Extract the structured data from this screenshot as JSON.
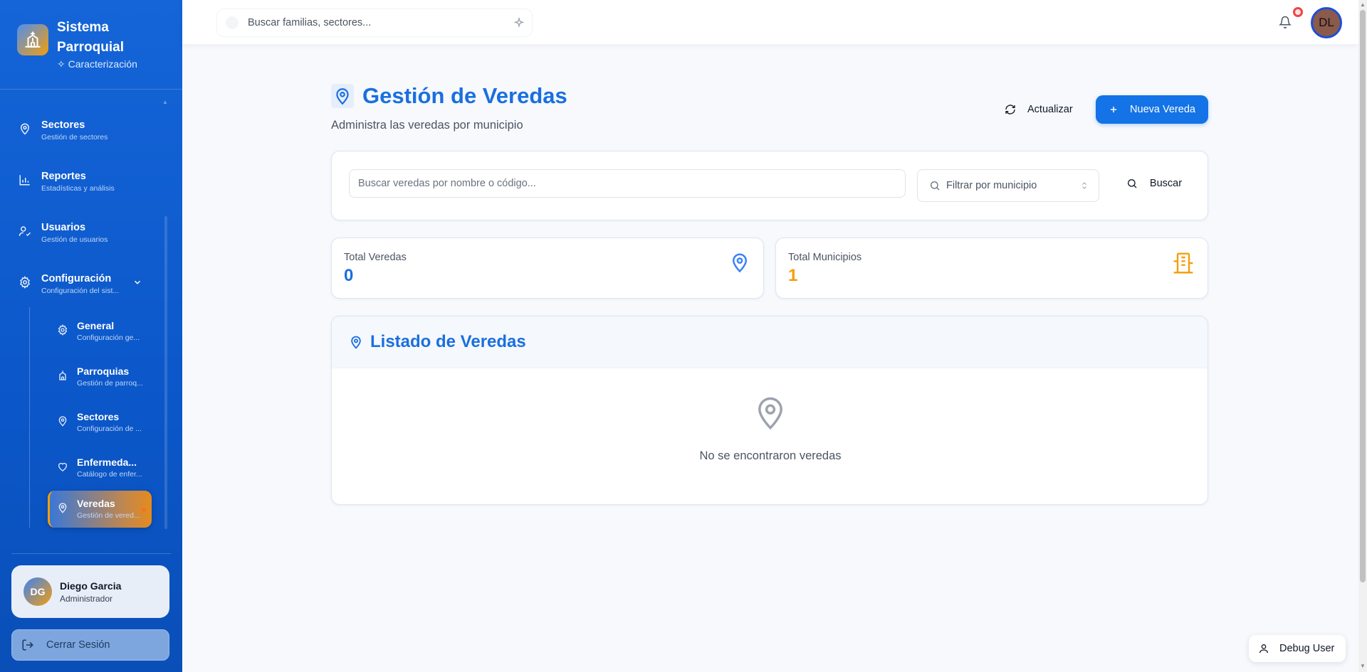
{
  "brand": {
    "title": "Sistema Parroquial",
    "subtitle": "Caracterización"
  },
  "sidebar": {
    "items": [
      {
        "label": "Sectores",
        "desc": "Gestión de sectores"
      },
      {
        "label": "Reportes",
        "desc": "Estadísticas y análisis"
      },
      {
        "label": "Usuarios",
        "desc": "Gestión de usuarios"
      },
      {
        "label": "Configuración",
        "desc": "Configuración del sist..."
      }
    ],
    "subitems": [
      {
        "label": "General",
        "desc": "Configuración ge..."
      },
      {
        "label": "Parroquias",
        "desc": "Gestión de parroq..."
      },
      {
        "label": "Sectores",
        "desc": "Configuración de ..."
      },
      {
        "label": "Enfermeda...",
        "desc": "Catálogo de enfer..."
      },
      {
        "label": "Veredas",
        "desc": "Gestión de vered..."
      }
    ]
  },
  "user": {
    "initials": "DG",
    "name": "Diego Garcia",
    "role": "Administrador"
  },
  "logout_label": "Cerrar Sesión",
  "topbar": {
    "search_placeholder": "Buscar familias, sectores...",
    "avatar_initials": "DL"
  },
  "page": {
    "title": "Gestión de Veredas",
    "subtitle": "Administra las veredas por municipio",
    "refresh_label": "Actualizar",
    "new_label": "Nueva Vereda"
  },
  "filters": {
    "search_placeholder": "Buscar veredas por nombre o código...",
    "municipio_placeholder": "Filtrar por municipio",
    "search_button": "Buscar"
  },
  "stats": [
    {
      "label": "Total Veredas",
      "value": "0",
      "color": "#1a6fe0"
    },
    {
      "label": "Total Municipios",
      "value": "1",
      "color": "#f59e0b"
    }
  ],
  "list": {
    "title": "Listado de Veredas",
    "empty": "No se encontraron veredas"
  },
  "debug_label": "Debug User",
  "colors": {
    "primary": "#1473e6",
    "accent": "#f59e0b",
    "sidebar": "#1565d8"
  }
}
